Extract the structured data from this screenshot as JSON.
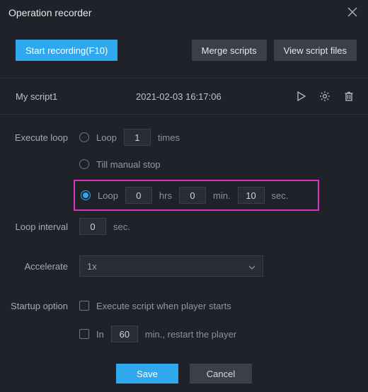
{
  "window": {
    "title": "Operation recorder"
  },
  "toolbar": {
    "start_label": "Start recording(F10)",
    "merge_label": "Merge scripts",
    "view_label": "View script files"
  },
  "script": {
    "name": "My script1",
    "timestamp": "2021-02-03 16:17:06"
  },
  "form": {
    "execute_loop_label": "Execute loop",
    "loop_label": "Loop",
    "loop_times_value": "1",
    "times_unit": "times",
    "till_manual_label": "Till manual stop",
    "loop_h": "0",
    "loop_m": "0",
    "loop_s": "10",
    "hrs_unit": "hrs",
    "min_unit": "min.",
    "sec_unit": "sec.",
    "loop_interval_label": "Loop interval",
    "loop_interval_value": "0",
    "accelerate_label": "Accelerate",
    "accelerate_value": "1x",
    "startup_label": "Startup option",
    "startup_check_label": "Execute script when player starts",
    "in_label": "In",
    "restart_value": "60",
    "restart_suffix": "min., restart the player"
  },
  "footer": {
    "save_label": "Save",
    "cancel_label": "Cancel"
  }
}
